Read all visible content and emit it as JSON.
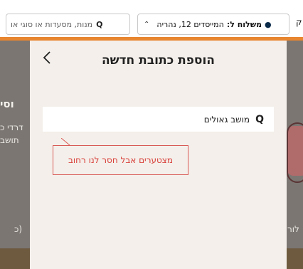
{
  "topbar": {
    "delivery_prefix": "משלוח ל:",
    "delivery_address": "המייסדים 12, נהריה",
    "search_placeholder": "מנות, מסעדות או סוגי או",
    "edge_letter": "ק",
    "accent_color": "#e8852f"
  },
  "background": {
    "fragments": [
      "וסי",
      "דרדי כ",
      "תושב",
      "(כ",
      "לור"
    ]
  },
  "modal": {
    "title": "הוספת כתובת חדשה",
    "address_value": "מושב גאולים",
    "error_text": "מצטערים אבל חסר לנו רחוב",
    "error_color": "#d9413c",
    "icons": [
      "chevron-left-icon",
      "search-icon"
    ]
  }
}
